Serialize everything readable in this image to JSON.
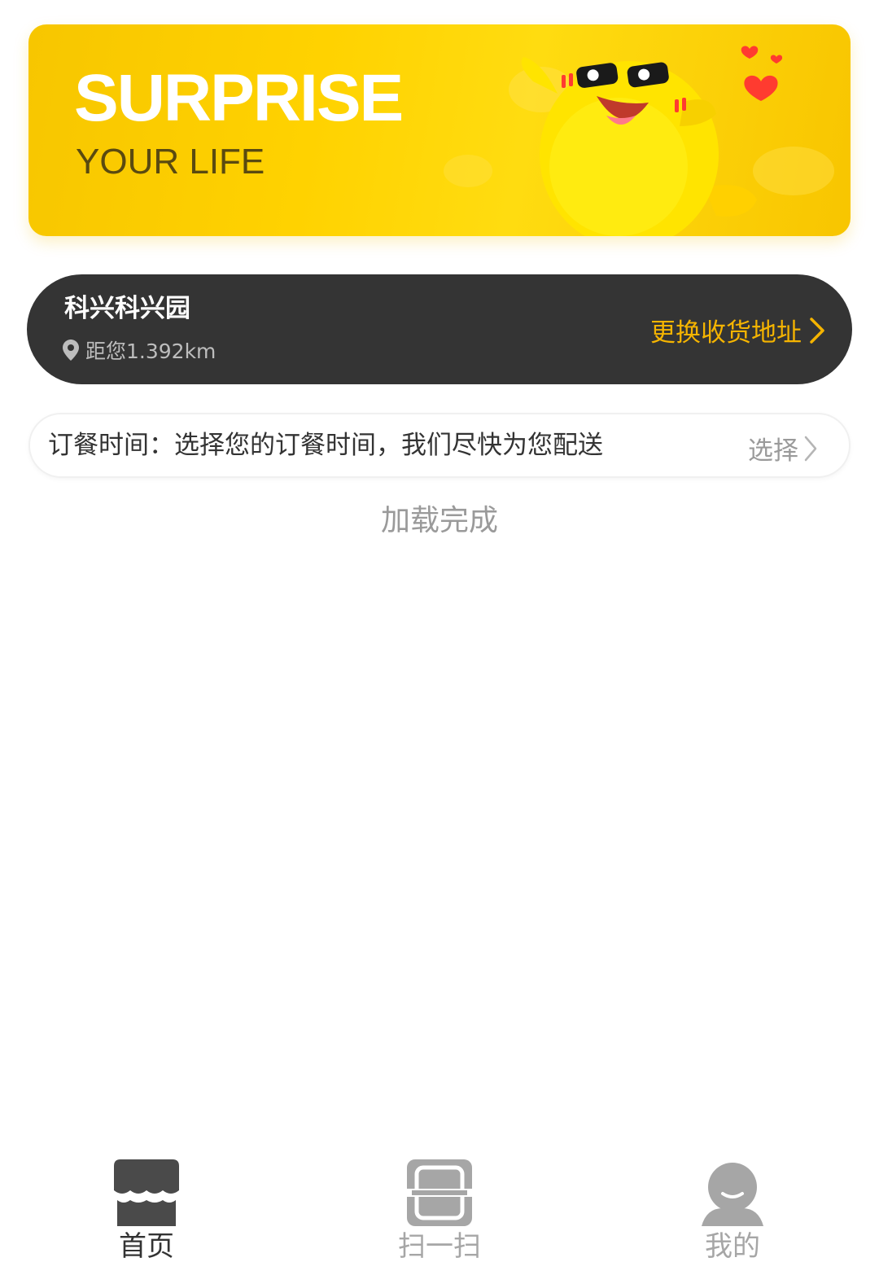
{
  "banner": {
    "title": "SURPRISE",
    "subtitle": "YOUR LIFE"
  },
  "address": {
    "name": "科兴科兴园",
    "distance": "距您1.392km",
    "change_label": "更换收货地址",
    "location_icon": "location-pin-icon",
    "chevron_icon": "chevron-right-icon"
  },
  "order_time": {
    "text": "订餐时间：选择您的订餐时间，我们尽快为您配送",
    "select_label": "选择",
    "chevron_icon": "chevron-right-icon"
  },
  "status": {
    "loading_text": "加载完成"
  },
  "tabbar": {
    "tabs": [
      {
        "label": "首页",
        "icon": "store-icon",
        "active": true
      },
      {
        "label": "扫一扫",
        "icon": "scan-icon",
        "active": false
      },
      {
        "label": "我的",
        "icon": "user-icon",
        "active": false
      }
    ]
  },
  "colors": {
    "banner_yellow": "#ffd200",
    "accent_orange": "#f5b400",
    "address_bg": "#343434",
    "active_tab": "#4a4a4a",
    "inactive_tab": "#a6a6a6"
  }
}
